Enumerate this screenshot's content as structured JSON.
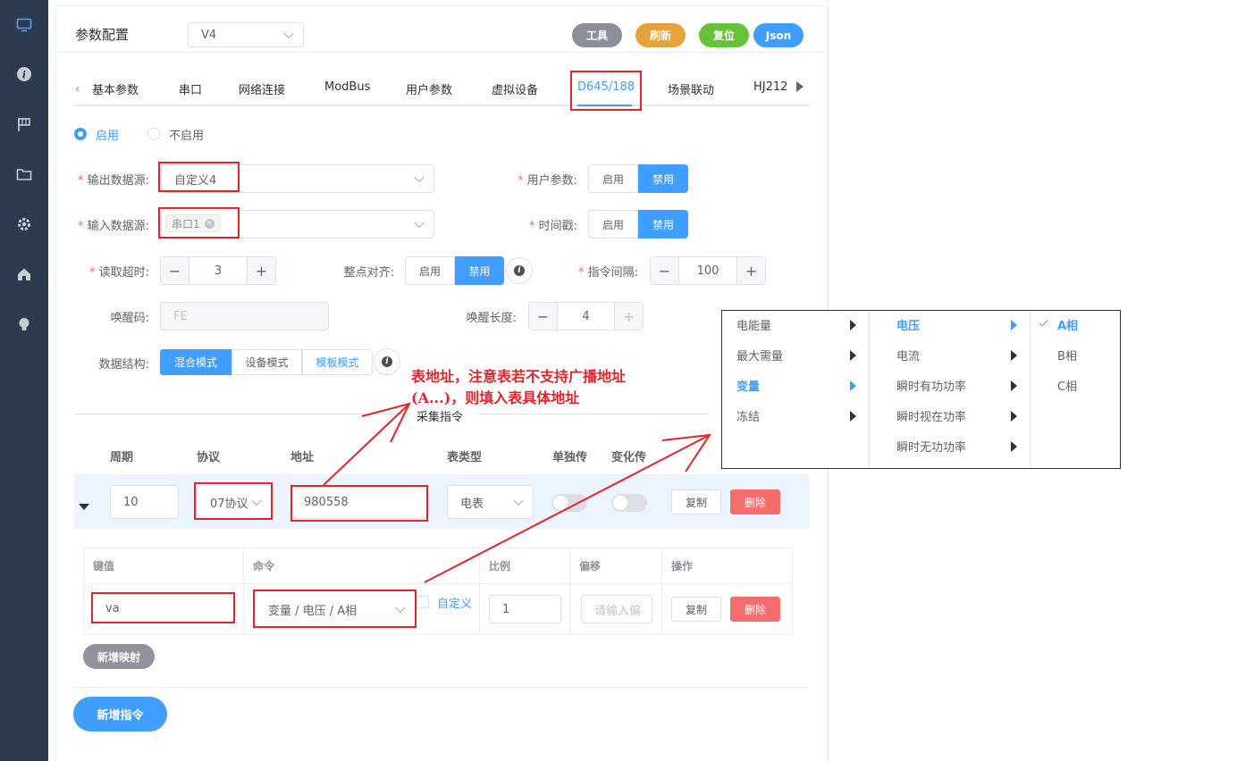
{
  "header": {
    "title": "参数配置",
    "version_select": "V4",
    "buttons": {
      "tools": "工具",
      "refresh": "刷新",
      "reset": "复位",
      "json": "Json"
    }
  },
  "tabs": [
    "基本参数",
    "串口",
    "网络连接",
    "ModBus",
    "用户参数",
    "虚拟设备",
    "D645/188",
    "场景联动",
    "HJ212"
  ],
  "active_tab": "D645/188",
  "enable": {
    "on_label": "启用",
    "off_label": "不启用"
  },
  "form": {
    "output_source_label": "输出数据源:",
    "output_source_value": "自定义4",
    "user_param_label": "用户参数:",
    "input_source_label": "输入数据源:",
    "input_source_tag": "串口1",
    "timestamp_label": "时间戳:",
    "read_timeout_label": "读取超时:",
    "read_timeout_value": "3",
    "hour_align_label": "整点对齐:",
    "cmd_interval_label": "指令间隔:",
    "cmd_interval_value": "100",
    "wake_code_label": "唤醒码:",
    "wake_code_value": "FE",
    "wake_len_label": "唤醒长度:",
    "wake_len_value": "4",
    "data_struct_label": "数据结构:",
    "modes": [
      "混合模式",
      "设备模式",
      "模板模式"
    ],
    "toggle_on": "启用",
    "toggle_off": "禁用"
  },
  "collect": {
    "title": "采集指令",
    "columns": [
      "周期",
      "协议",
      "地址",
      "表类型",
      "单独传",
      "变化传"
    ],
    "row": {
      "period": "10",
      "protocol": "07协议",
      "address": "980558",
      "meter_type": "电表",
      "copy": "复制",
      "delete": "删除"
    }
  },
  "mapping": {
    "columns": [
      "键值",
      "命令",
      "比例",
      "偏移",
      "操作"
    ],
    "row": {
      "key": "va",
      "command": "变量 / 电压 / A相",
      "custom_label": "自定义",
      "ratio": "1",
      "offset_placeholder": "请输入偏",
      "copy": "复制",
      "delete": "删除"
    },
    "add_button": "新增映射"
  },
  "add_cmd_button": "新增指令",
  "annotation": {
    "line1": "表地址，注意表若不支持广播地址",
    "line2": "(A...)，则填入表具体地址"
  },
  "cascader": {
    "col1": [
      "电能量",
      "最大需量",
      "变量",
      "冻结"
    ],
    "col2": [
      "电压",
      "电流",
      "瞬时有功功率",
      "瞬时视在功率",
      "瞬时无功功率"
    ],
    "col3": [
      "A相",
      "B相",
      "C相"
    ]
  },
  "colors": {
    "primary": "#409eff",
    "danger": "#f56c6c",
    "sidebar": "#2e3a4e",
    "annotation": "#e0262c",
    "tools_btn": "#8a8f98",
    "refresh_btn": "#e6a23c",
    "reset_btn": "#67c23a"
  }
}
